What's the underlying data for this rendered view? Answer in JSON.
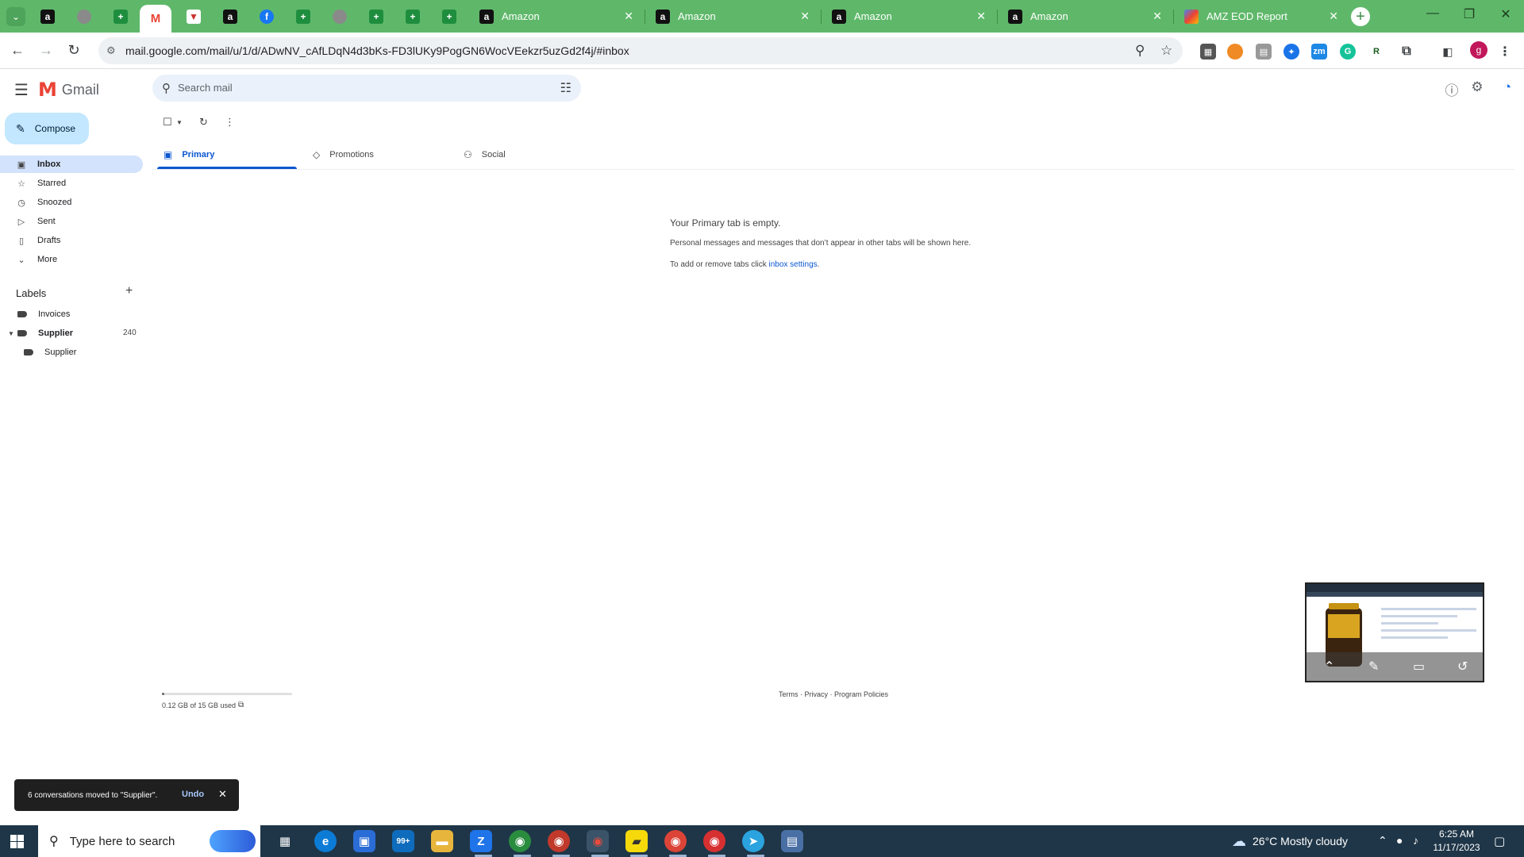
{
  "browser": {
    "pinned_tabs": [
      {
        "icon": "amazon-icon",
        "glyph": "a"
      },
      {
        "icon": "globe-icon",
        "glyph": ""
      },
      {
        "icon": "sheets-icon",
        "glyph": "+"
      },
      {
        "icon": "gmail-icon",
        "glyph": "M"
      },
      {
        "icon": "vpn-icon",
        "glyph": "▼"
      },
      {
        "icon": "amazon-icon",
        "glyph": "a"
      },
      {
        "icon": "facebook-icon",
        "glyph": "f"
      },
      {
        "icon": "sheets-icon",
        "glyph": "+"
      },
      {
        "icon": "globe-icon",
        "glyph": ""
      },
      {
        "icon": "sheets-icon",
        "glyph": "+"
      },
      {
        "icon": "sheets-icon",
        "glyph": "+"
      },
      {
        "icon": "sheets-icon",
        "glyph": "+"
      }
    ],
    "tabs": [
      {
        "title": "Amazon",
        "icon": "amazon-icon"
      },
      {
        "title": "Amazon",
        "icon": "amazon-icon"
      },
      {
        "title": "Amazon",
        "icon": "amazon-icon"
      },
      {
        "title": "Amazon",
        "icon": "amazon-icon"
      },
      {
        "title": "AMZ EOD Report",
        "icon": "looker-icon"
      }
    ],
    "url": "mail.google.com/mail/u/1/d/ADwNV_cAfLDqN4d3bKs-FD3lUKy9PogGN6WocVEekzr5uzGd2f4j/#inbox",
    "profile_initial": "g",
    "colors": {
      "tabbar": "#5fb86a",
      "accent": "#0b57d0"
    }
  },
  "gmail": {
    "brand": "Gmail",
    "search_placeholder": "Search mail",
    "compose_label": "Compose",
    "nav": [
      {
        "label": "Inbox",
        "icon": "inbox-icon",
        "glyph": "▣",
        "active": true
      },
      {
        "label": "Starred",
        "icon": "star-icon",
        "glyph": "☆"
      },
      {
        "label": "Snoozed",
        "icon": "clock-icon",
        "glyph": "◷"
      },
      {
        "label": "Sent",
        "icon": "send-icon",
        "glyph": "▷"
      },
      {
        "label": "Drafts",
        "icon": "draft-icon",
        "glyph": "▯"
      },
      {
        "label": "More",
        "icon": "chevron-down-icon",
        "glyph": "⌄"
      }
    ],
    "labels_title": "Labels",
    "labels": [
      {
        "label": "Invoices"
      },
      {
        "label": "Supplier",
        "count": "240",
        "bold": true
      },
      {
        "label": "Supplier",
        "nested": true
      }
    ],
    "category_tabs": [
      {
        "label": "Primary",
        "icon": "inbox-icon",
        "glyph": "▣",
        "active": true
      },
      {
        "label": "Promotions",
        "icon": "tag-icon",
        "glyph": "◇"
      },
      {
        "label": "Social",
        "icon": "people-icon",
        "glyph": "⚇"
      }
    ],
    "empty": {
      "title": "Your Primary tab is empty.",
      "line1": "Personal messages and messages that don’t appear in other tabs will be shown here.",
      "line2_prefix": "To add or remove tabs click ",
      "line2_link": "inbox settings",
      "line2_suffix": "."
    },
    "storage": {
      "text": "0.12 GB of 15 GB used",
      "used_fraction": 0.008
    },
    "footer": "Terms · Privacy · Program Policies",
    "toast": {
      "message": "6 conversations moved to \"Supplier\".",
      "action": "Undo"
    }
  },
  "taskbar": {
    "search_placeholder": "Type here to search",
    "weather": "26°C  Mostly cloudy",
    "time": "6:25 AM",
    "date": "11/17/2023",
    "badge_mail": "99+"
  }
}
